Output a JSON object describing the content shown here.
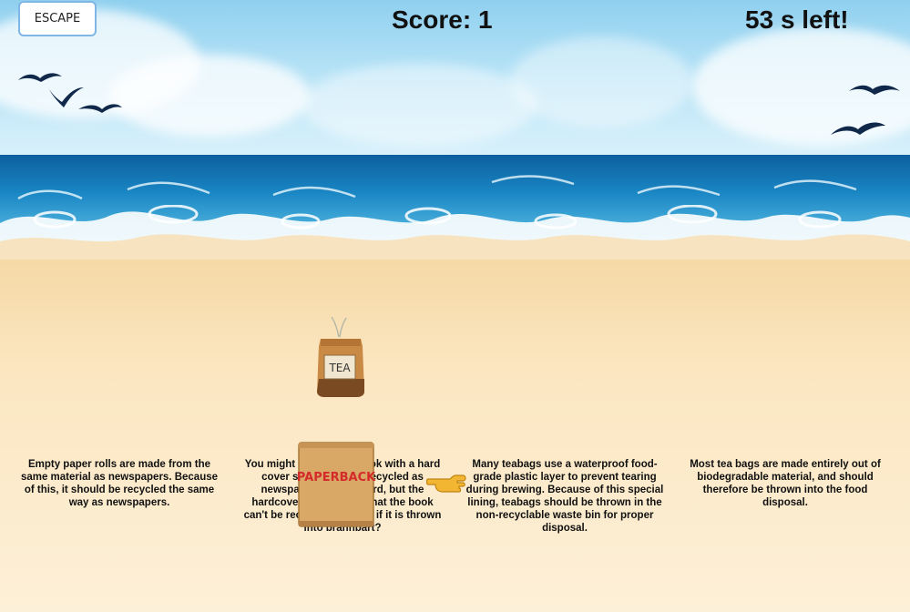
{
  "game": {
    "escape_label": "ESCAPE",
    "score_label": "Score:",
    "score_value": "1",
    "time_value": "53",
    "time_suffix": "s left!"
  },
  "items": {
    "tea_label": "TEA",
    "paperback_label": "PAPERBACK"
  },
  "facts": [
    "Empty paper rolls are made from the same material as newspapers. Because of this, it should be recycled the same way as newspapers.",
    "You might think that a book with a hard cover should just be recycled as newspaper or cardboard, but the hardcover is so strong that the book can't be recycled properly if it is thrown into brännbart?",
    "Many teabags use a waterproof food-grade plastic layer to prevent tearing during brewing. Because of this special lining, teabags should be thrown in the non-recyclable waste bin for proper disposal.",
    "Most tea bags are made entirely out of biodegradable material, and should therefore be thrown into the food disposal."
  ],
  "icons": {
    "pointer": "pointing-hand-icon",
    "birds": "seagull-icon"
  },
  "colors": {
    "sea_dark": "#0c5f9e",
    "sand": "#fbe6c0",
    "escape_border": "#7fb6e6"
  }
}
